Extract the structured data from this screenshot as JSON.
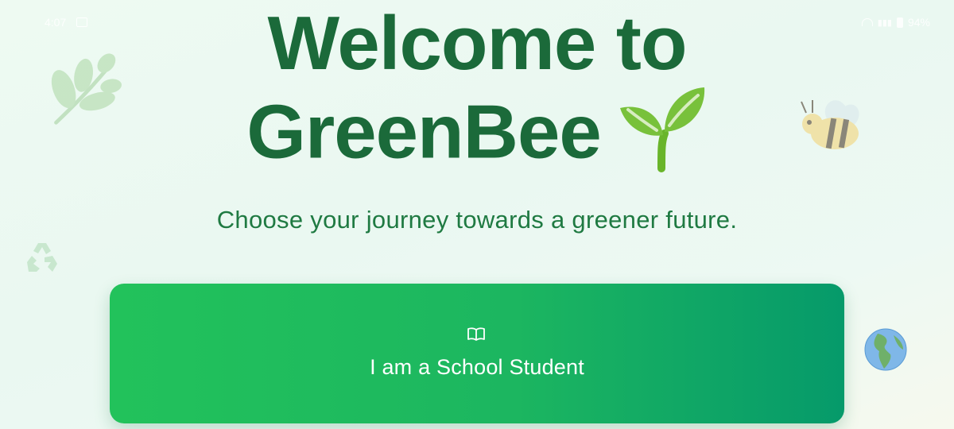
{
  "status_bar": {
    "time": "4:07",
    "battery": "94%"
  },
  "header": {
    "title_line1": "Welcome to",
    "title_line2": "GreenBee",
    "subtitle": "Choose your journey towards a greener future."
  },
  "options": [
    {
      "label": "I am a School Student",
      "icon": "book-icon"
    }
  ],
  "icons": {
    "title_icon": "sprout-icon",
    "decorations": [
      "leaf-icon",
      "bee-icon",
      "recycle-icon",
      "globe-icon"
    ]
  },
  "colors": {
    "title": "#1b6a3a",
    "subtitle": "#1f7a42",
    "button_start": "#22c25b",
    "button_end": "#069a6a",
    "background": "#eaf8f1"
  }
}
